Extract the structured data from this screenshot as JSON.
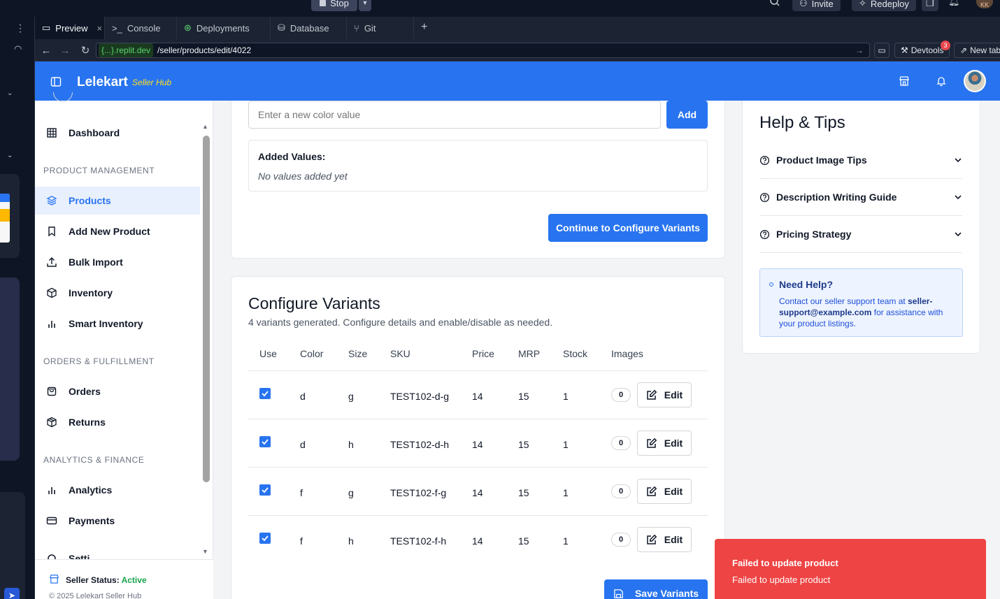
{
  "replit": {
    "stop_label": "Stop",
    "invite_label": "Invite",
    "redeploy_label": "Redeploy",
    "avatar_initials": "KK",
    "tabs": [
      {
        "label": "Preview",
        "icon": "monitor-icon"
      },
      {
        "label": "Console",
        "icon": "terminal-icon"
      },
      {
        "label": "Deployments",
        "icon": "deploy-icon"
      },
      {
        "label": "Database",
        "icon": "database-icon"
      },
      {
        "label": "Git",
        "icon": "git-icon"
      }
    ],
    "url_domain": "{...}.replit.dev",
    "url_path": "/seller/products/edit/4022",
    "devtools_label": "Devtools",
    "devtools_badge": "3",
    "newtab_label": "New tab"
  },
  "header": {
    "brand": "Lelekart",
    "subbrand": "Seller Hub",
    "color": "#2874f0"
  },
  "sidebar": {
    "dashboard": "Dashboard",
    "sections": [
      {
        "title": "PRODUCT MANAGEMENT",
        "items": [
          {
            "label": "Products",
            "icon": "layers-icon",
            "active": true
          },
          {
            "label": "Add New Product",
            "icon": "bookmark-icon"
          },
          {
            "label": "Bulk Import",
            "icon": "upload-icon"
          },
          {
            "label": "Inventory",
            "icon": "package-icon"
          },
          {
            "label": "Smart Inventory",
            "icon": "bar-chart-icon"
          }
        ]
      },
      {
        "title": "ORDERS & FULFILLMENT",
        "items": [
          {
            "label": "Orders",
            "icon": "shopping-bag-icon"
          },
          {
            "label": "Returns",
            "icon": "returns-icon"
          }
        ]
      },
      {
        "title": "ANALYTICS & FINANCE",
        "items": [
          {
            "label": "Analytics",
            "icon": "bar-chart-icon"
          },
          {
            "label": "Payments",
            "icon": "credit-card-icon"
          },
          {
            "label": "Setti",
            "icon": "gear-icon"
          }
        ]
      }
    ],
    "seller_status_label": "Seller Status:",
    "seller_status_value": "Active",
    "copyright": "© 2025 Lelekart Seller Hub"
  },
  "color_input": {
    "placeholder": "Enter a new color value",
    "add_label": "Add",
    "added_values_title": "Added Values:",
    "empty_text": "No values added yet",
    "continue_label": "Continue to Configure Variants"
  },
  "variants": {
    "title": "Configure Variants",
    "subtitle": "4 variants generated. Configure details and enable/disable as needed.",
    "columns": [
      "Use",
      "Color",
      "Size",
      "SKU",
      "Price",
      "MRP",
      "Stock",
      "Images"
    ],
    "rows": [
      {
        "color": "d",
        "size": "g",
        "sku": "TEST102-d-g",
        "price": "14",
        "mrp": "15",
        "stock": "1",
        "images": "0",
        "edit": "Edit"
      },
      {
        "color": "d",
        "size": "h",
        "sku": "TEST102-d-h",
        "price": "14",
        "mrp": "15",
        "stock": "1",
        "images": "0",
        "edit": "Edit"
      },
      {
        "color": "f",
        "size": "g",
        "sku": "TEST102-f-g",
        "price": "14",
        "mrp": "15",
        "stock": "1",
        "images": "0",
        "edit": "Edit"
      },
      {
        "color": "f",
        "size": "h",
        "sku": "TEST102-f-h",
        "price": "14",
        "mrp": "15",
        "stock": "1",
        "images": "0",
        "edit": "Edit"
      }
    ],
    "save_label": "Save Variants"
  },
  "help": {
    "title": "Help & Tips",
    "items": [
      "Product Image Tips",
      "Description Writing Guide",
      "Pricing Strategy"
    ],
    "need_help_title": "Need Help?",
    "need_help_pre": "Contact our seller support team at ",
    "need_help_email": "seller-support@example.com",
    "need_help_post": " for assistance with your product listings."
  },
  "toast": {
    "title": "Failed to update product",
    "message": "Failed to update product",
    "color": "#ef4444"
  }
}
